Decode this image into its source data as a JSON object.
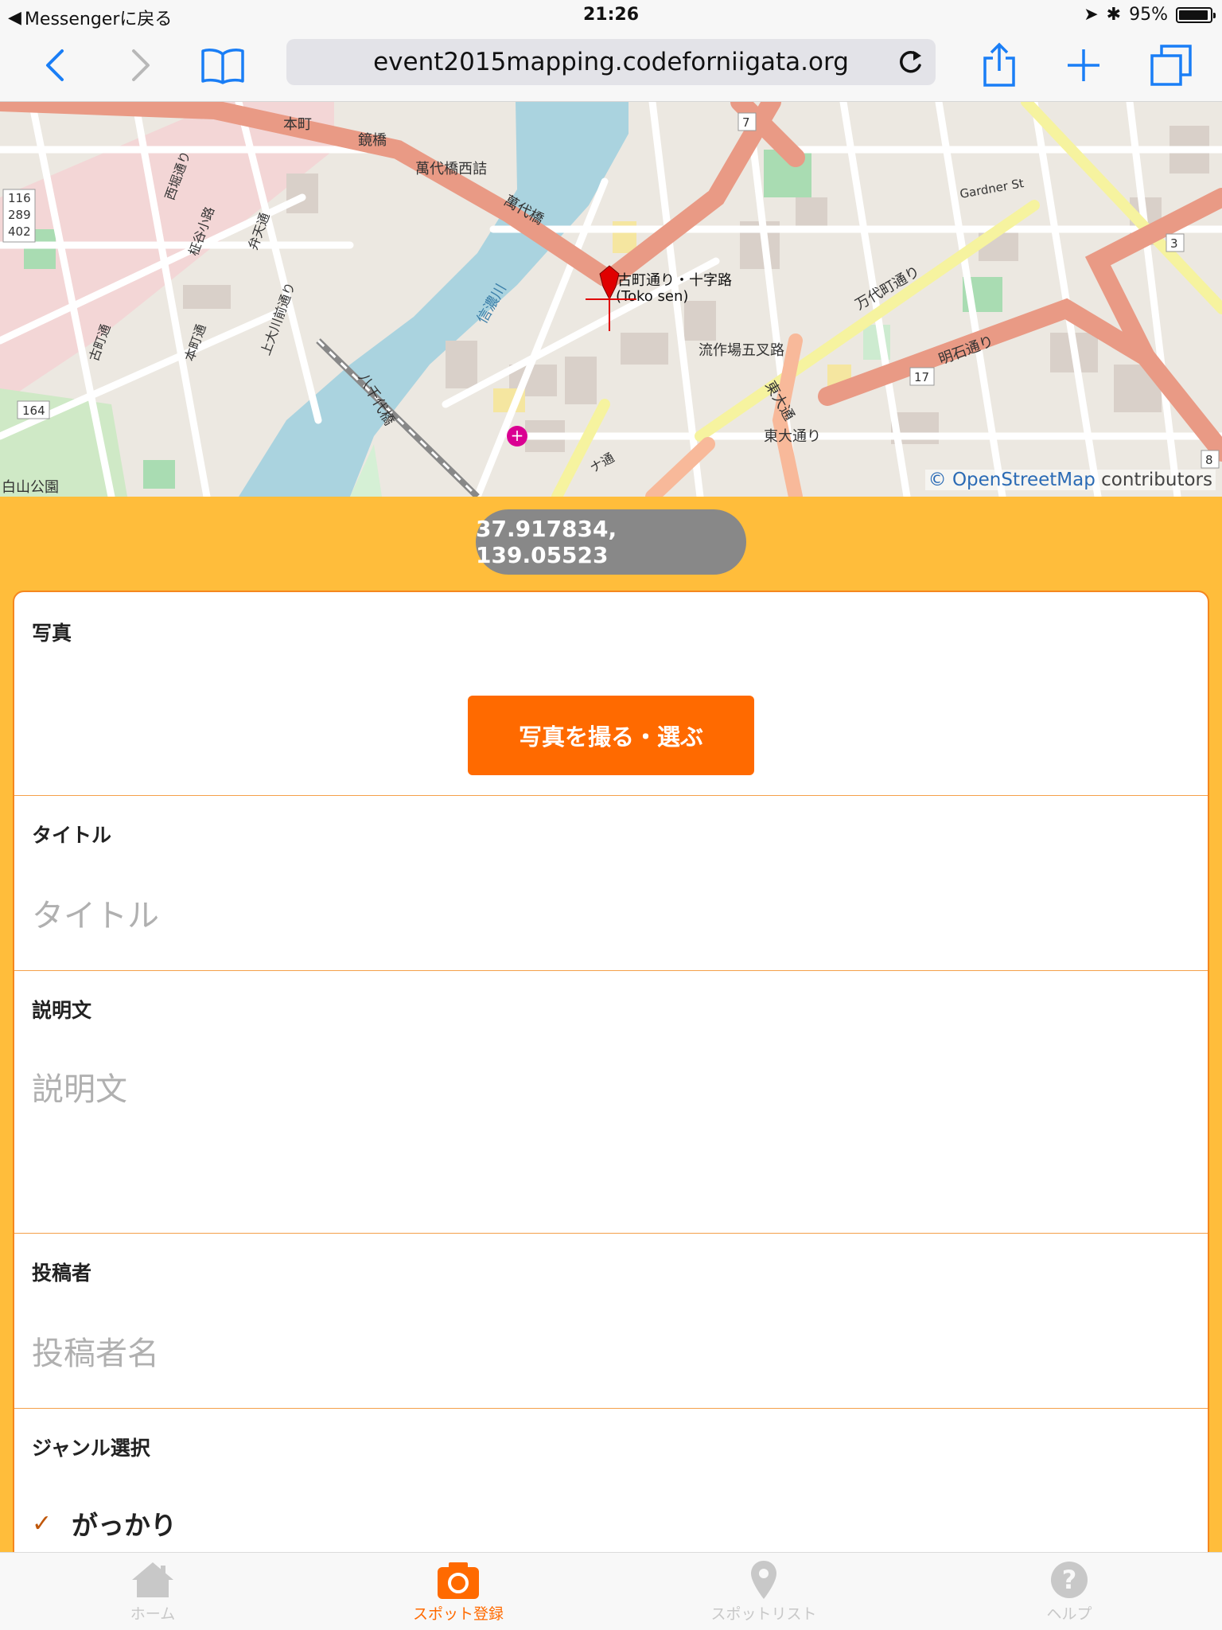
{
  "status_bar": {
    "back_label": "Messengerに戻る",
    "time": "21:26",
    "battery": "95%",
    "battery_level": 0.95
  },
  "browser": {
    "url": "event2015mapping.codeforniigata.org"
  },
  "map": {
    "attribution_link": "OpenStreetMap",
    "attribution_rest": " contributors",
    "marker_label_1": "古町通り・十字路",
    "marker_label_2": "(Toko sen)",
    "street_labels": [
      "本町",
      "鏡橋",
      "萬代橋西詰",
      "萬代橋",
      "信濃川",
      "八千代橋",
      "万代町通り",
      "明石通り",
      "流作場五叉路",
      "東大通り",
      "東大通",
      "Gardner St",
      "白山公園",
      "古町通",
      "本町通",
      "上大川前通り",
      "西堀通り",
      "柾谷小路",
      "弁天通",
      "ナ通"
    ],
    "road_numbers": [
      "7",
      "3",
      "17",
      "8",
      "164",
      "116",
      "289",
      "402"
    ]
  },
  "coordinates": "37.917834, 139.05523",
  "form": {
    "photo": {
      "label": "写真",
      "button": "写真を撮る・選ぶ"
    },
    "title": {
      "label": "タイトル",
      "placeholder": "タイトル"
    },
    "description": {
      "label": "説明文",
      "placeholder": "説明文"
    },
    "poster": {
      "label": "投稿者",
      "placeholder": "投稿者名"
    },
    "genre": {
      "label": "ジャンル選択",
      "selected": "がっかり"
    }
  },
  "tabs": [
    {
      "label": "ホーム",
      "icon": "home-icon",
      "active": false
    },
    {
      "label": "スポット登録",
      "icon": "camera-icon",
      "active": true
    },
    {
      "label": "スポットリスト",
      "icon": "map-pin-icon",
      "active": false
    },
    {
      "label": "ヘルプ",
      "icon": "help-icon",
      "active": false
    }
  ],
  "colors": {
    "accent": "#ff6a00",
    "background": "#ffbd3b",
    "ios_blue": "#1a7ef6"
  }
}
